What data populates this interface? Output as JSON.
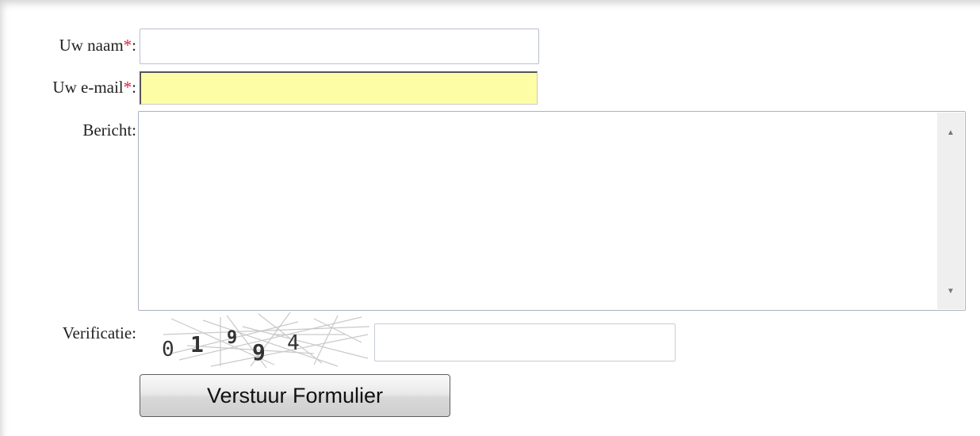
{
  "form": {
    "name_label": "Uw naam",
    "email_label": "Uw e-mail",
    "message_label": "Bericht",
    "verification_label": "Verificatie",
    "required_marker": "*",
    "colon": ":",
    "name_value": "",
    "email_value": "",
    "message_value": "",
    "captcha_value": "",
    "submit_label": "Verstuur Formulier"
  },
  "captcha": {
    "digits": [
      "0",
      "1",
      "9",
      "9",
      "4"
    ]
  },
  "colors": {
    "required": "#e0203a",
    "email_highlight": "#fdfda6"
  },
  "icons": {
    "scroll_up": "triangle-up",
    "scroll_down": "triangle-down"
  }
}
